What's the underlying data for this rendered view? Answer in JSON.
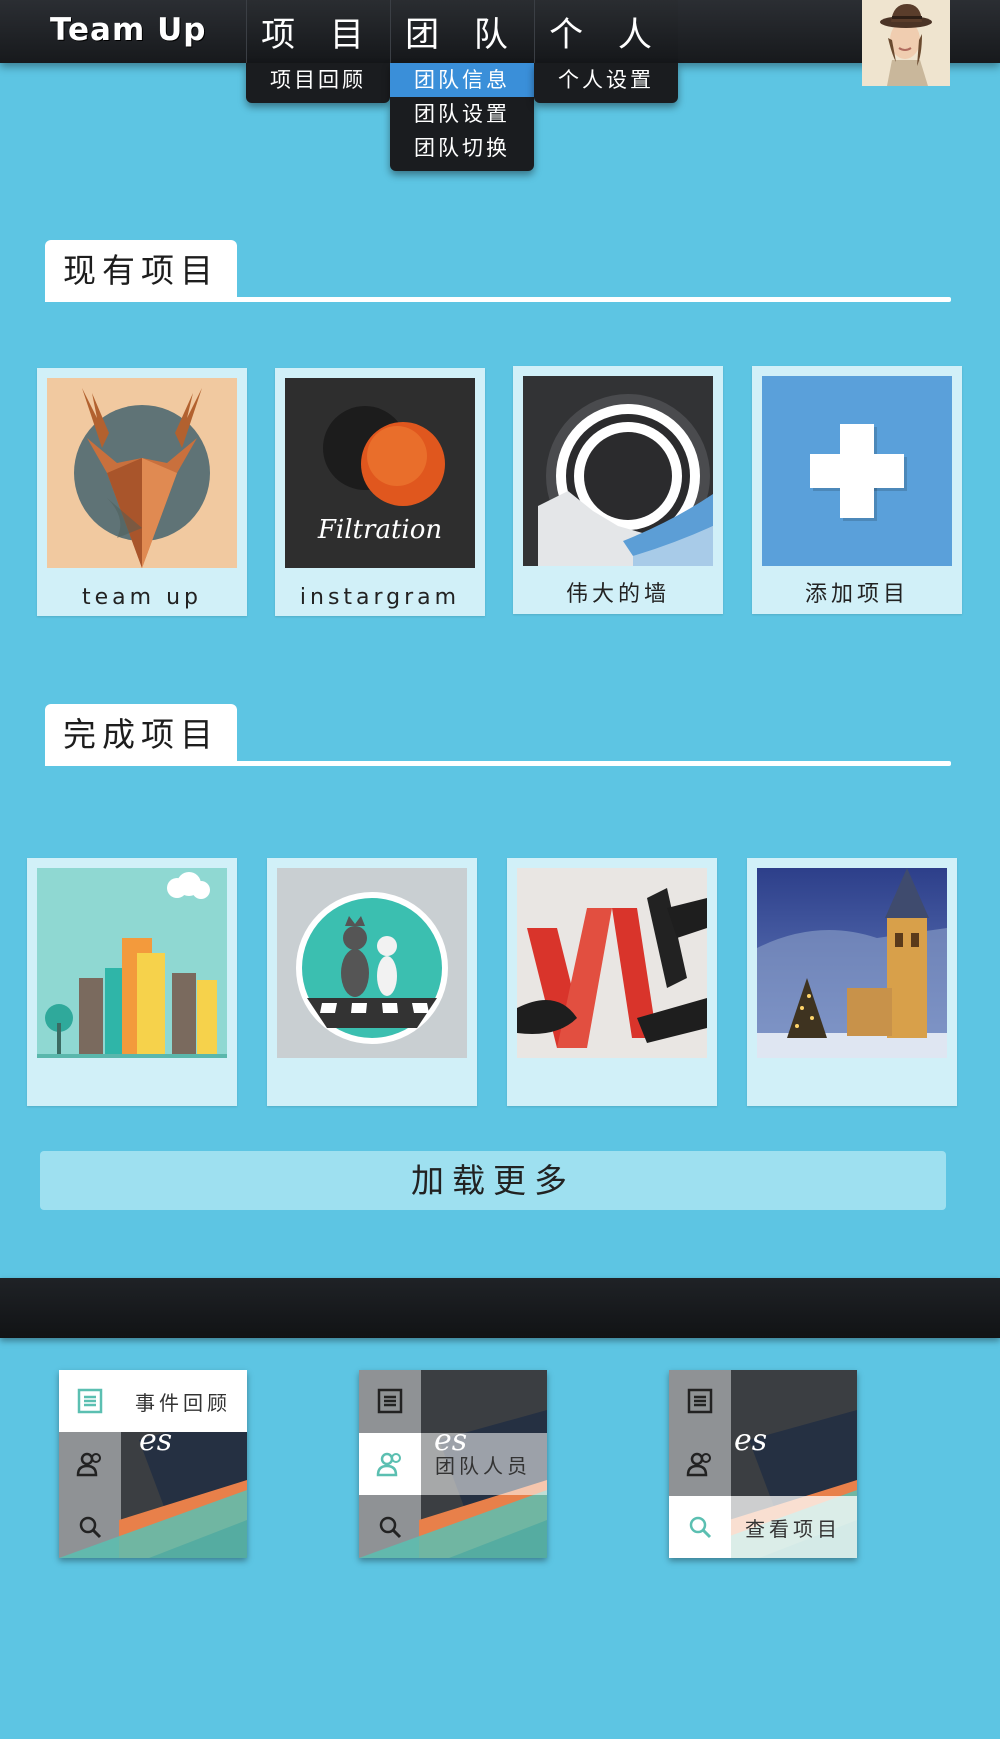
{
  "nav": {
    "logo": "Team Up",
    "menus": [
      {
        "title": "项 目",
        "items": [
          "项目回顾"
        ]
      },
      {
        "title": "团 队",
        "items": [
          "团队信息",
          "团队设置",
          "团队切换"
        ],
        "active_item": "团队信息"
      },
      {
        "title": "个 人",
        "items": [
          "个人设置"
        ]
      }
    ],
    "active_color": "#3a8fd9"
  },
  "current_projects": {
    "heading": "现有项目",
    "cards": [
      {
        "caption": "team up",
        "image": "origami-deer-image"
      },
      {
        "caption": "instargram",
        "image": "filtration-logo-image",
        "image_text": "Filtration"
      },
      {
        "caption": "伟大的墙",
        "image": "great-wall-rings-image"
      },
      {
        "caption": "添加项目",
        "image": "plus-icon"
      }
    ]
  },
  "finished_projects": {
    "heading": "完成项目",
    "cards": [
      {
        "image": "city-buildings-image"
      },
      {
        "image": "chess-cats-image"
      },
      {
        "image": "red-letters-image"
      },
      {
        "image": "snowy-church-image"
      }
    ]
  },
  "load_more": "加载更多",
  "tiles": [
    {
      "items": [
        {
          "icon": "list-icon",
          "label": "事件回顾"
        },
        {
          "icon": "people-icon",
          "label": ""
        },
        {
          "icon": "search-icon",
          "label": ""
        }
      ],
      "active": 0
    },
    {
      "items": [
        {
          "icon": "list-icon",
          "label": ""
        },
        {
          "icon": "people-icon",
          "label": "团队人员"
        },
        {
          "icon": "search-icon",
          "label": ""
        }
      ],
      "active": 1
    },
    {
      "items": [
        {
          "icon": "list-icon",
          "label": ""
        },
        {
          "icon": "people-icon",
          "label": ""
        },
        {
          "icon": "search-icon",
          "label": "查看项目"
        }
      ],
      "active": 2
    }
  ],
  "colors": {
    "background": "#5dc5e3",
    "card": "#d1f0f8",
    "accent_teal": "#5bbfb1",
    "orange": "#e8804a"
  }
}
